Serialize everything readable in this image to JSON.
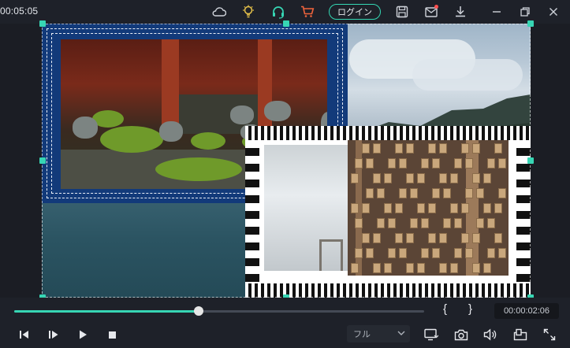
{
  "topbar": {
    "timecode": "00:05:05",
    "icons": [
      "cloud-icon",
      "bulb-icon",
      "headset-icon",
      "cart-icon",
      "save-icon",
      "mail-icon",
      "download-icon",
      "minimize-icon",
      "restore-icon",
      "close-icon"
    ],
    "login_label": "ログイン"
  },
  "colors": {
    "accent": "#37d6b4",
    "cart": "#f0643c",
    "bulb": "#e8c34a",
    "frame_blue": "#123a7a",
    "notify": "#ff4f4f"
  },
  "player": {
    "progress_percent": 45,
    "mark_in": "{",
    "mark_out": "}",
    "current_time": "00:00:02:06",
    "quality": "フル",
    "buttons": [
      "prev-frame",
      "next-frame",
      "play",
      "stop",
      "display-settings",
      "snapshot",
      "volume",
      "pip",
      "fullscreen"
    ]
  }
}
